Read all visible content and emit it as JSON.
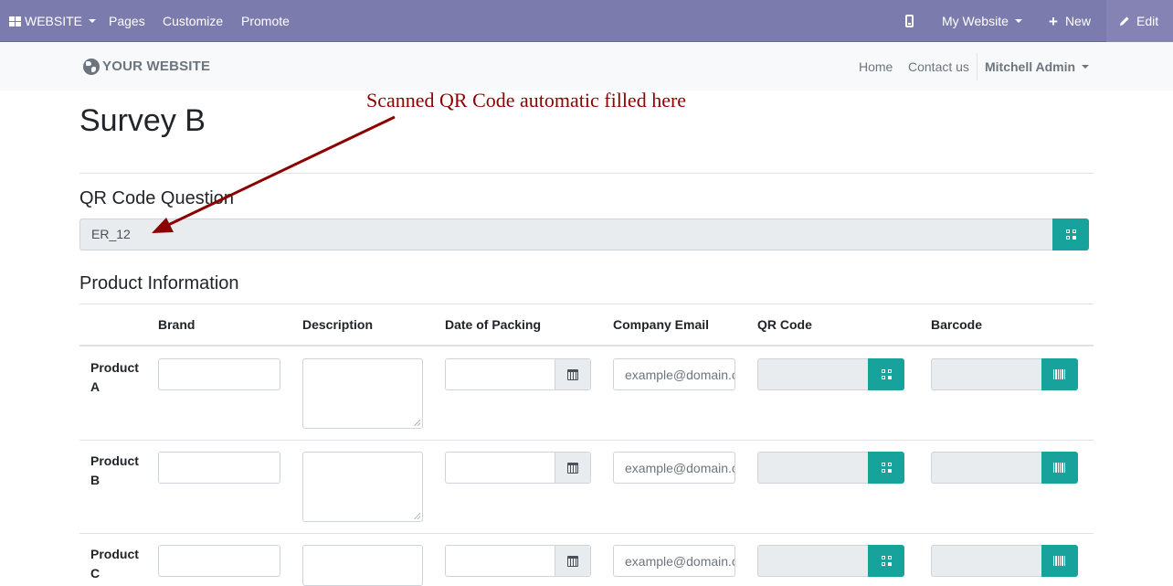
{
  "topbar": {
    "website_label": "WEBSITE",
    "pages_label": "Pages",
    "customize_label": "Customize",
    "promote_label": "Promote",
    "mobile_icon": "mobile-icon",
    "my_website_label": "My Website",
    "new_label": "New",
    "edit_label": "Edit"
  },
  "header": {
    "logo_text": "YOUR WEBSITE",
    "nav": [
      "Home",
      "Contact us"
    ],
    "user": "Mitchell Admin"
  },
  "annotation": "Scanned QR Code automatic filled here",
  "survey": {
    "title": "Survey B",
    "qr_question": {
      "label": "QR Code Question",
      "value": "ER_12"
    },
    "product_section": {
      "label": "Product Information",
      "columns": [
        "Brand",
        "Description",
        "Date of Packing",
        "Company Email",
        "QR Code",
        "Barcode"
      ],
      "rows": [
        {
          "label": "Product A",
          "email_placeholder": "example@domain.com"
        },
        {
          "label": "Product B",
          "email_placeholder": "example@domain.com"
        },
        {
          "label": "Product C",
          "email_placeholder": "example@domain.com"
        }
      ]
    }
  },
  "colors": {
    "topbar": "#7c7bad",
    "accent_button": "#17a39c",
    "annotation": "#8b0000"
  }
}
